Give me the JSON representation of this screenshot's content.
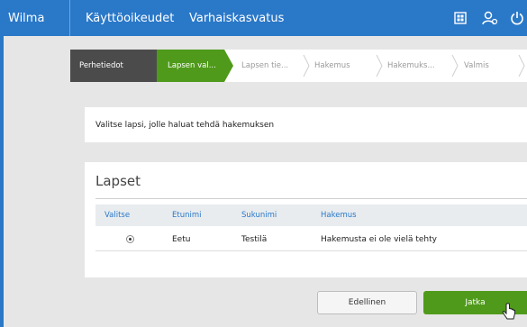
{
  "topbar": {
    "brand": "Wilma",
    "nav": [
      "Käyttöoikeudet",
      "Varhaiskasvatus"
    ],
    "icons": [
      "grid-icon",
      "user-settings-icon",
      "power-icon"
    ],
    "color": "#2a78c8"
  },
  "wizard": {
    "steps": [
      {
        "label": "Perhetiedot",
        "state": "done"
      },
      {
        "label": "Lapsen val...",
        "state": "active"
      },
      {
        "label": "Lapsen tie...",
        "state": "pending"
      },
      {
        "label": "Hakemus",
        "state": "pending"
      },
      {
        "label": "Hakemuks...",
        "state": "pending"
      },
      {
        "label": "Valmis",
        "state": "pending"
      }
    ],
    "done_color": "#4b4b4b",
    "active_color": "#4f9a1a"
  },
  "instruction": "Valitse lapsi, jolle haluat tehdä hakemuksen",
  "children": {
    "title": "Lapset",
    "headers": [
      "Valitse",
      "Etunimi",
      "Sukunimi",
      "Hakemus"
    ],
    "rows": [
      {
        "selected": true,
        "first": "Eetu",
        "last": "Testilä",
        "application": "Hakemusta ei ole vielä tehty"
      }
    ]
  },
  "buttons": {
    "previous": "Edellinen",
    "next": "Jatka"
  }
}
